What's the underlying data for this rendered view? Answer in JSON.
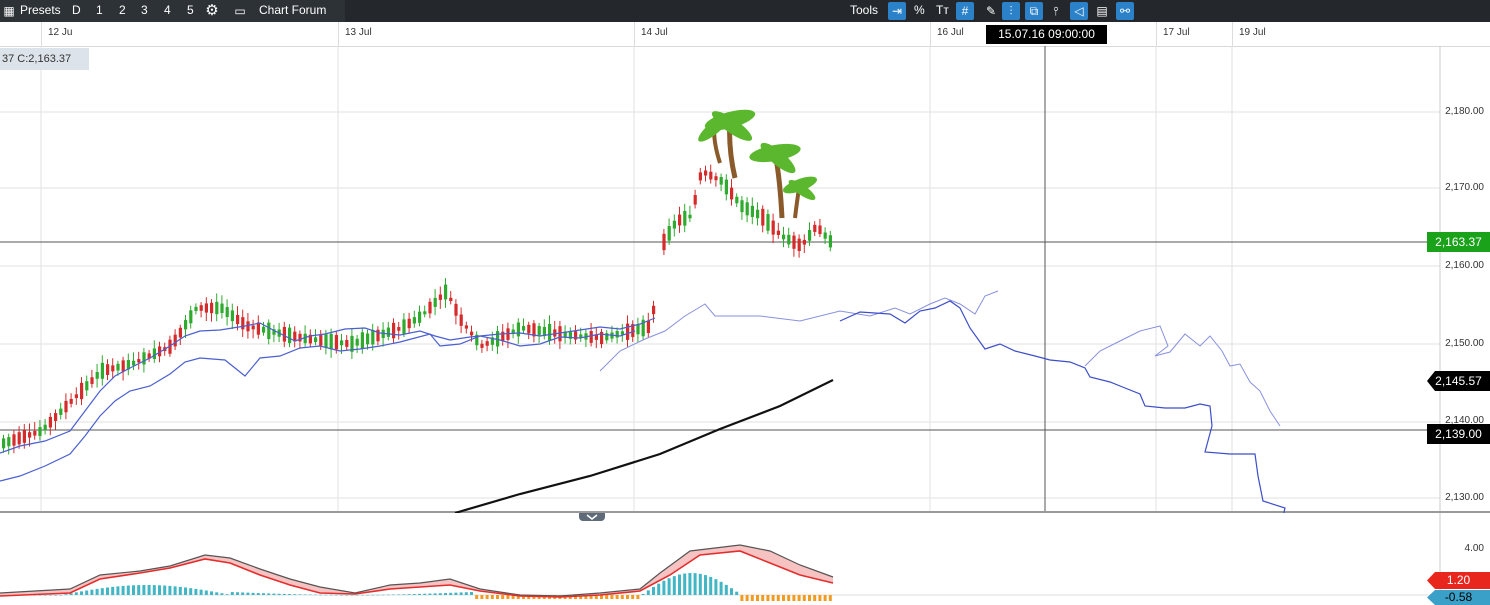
{
  "toolbar": {
    "presets_label": "Presets",
    "presets": [
      "D",
      "1",
      "2",
      "3",
      "4",
      "5"
    ],
    "chart_forum_label": "Chart Forum",
    "tools_label": "Tools",
    "percent_label": "%",
    "text_label": "Tт"
  },
  "date_axis": {
    "labels": [
      "12 Ju",
      "13 Jul",
      "14 Jul",
      "16 Jul",
      "17 Jul",
      "19 Jul"
    ],
    "crosshair_time": "15.07.16 09:00:00"
  },
  "ohlc_readout": "37  C:2,163.37",
  "price_axis": {
    "labels": [
      "2,180.00",
      "2,170.00",
      "2,160.00",
      "2,150.00",
      "2,140.00",
      "2,130.00"
    ],
    "tags": {
      "last_price": "2,163.37",
      "marker_price": "2,145.57",
      "crosshair_price": "2,139.00"
    }
  },
  "indicator_axis": {
    "label": "4.00",
    "tags": {
      "macd_value": "1.20",
      "signal_value": "-0.58"
    }
  },
  "colors": {
    "toolbar_bg": "#24282c",
    "active_tool": "#2b82c9",
    "bull": "#2eab2e",
    "bear": "#d62b2b",
    "last_price_tag": "#1aa21a",
    "macd_tag": "#e8261d",
    "signal_tag": "#3aa0c8"
  },
  "icons": [
    "calendar-icon",
    "gear-icon",
    "chat-icon",
    "chevron-updown-icon",
    "palm-tree-icon"
  ]
}
